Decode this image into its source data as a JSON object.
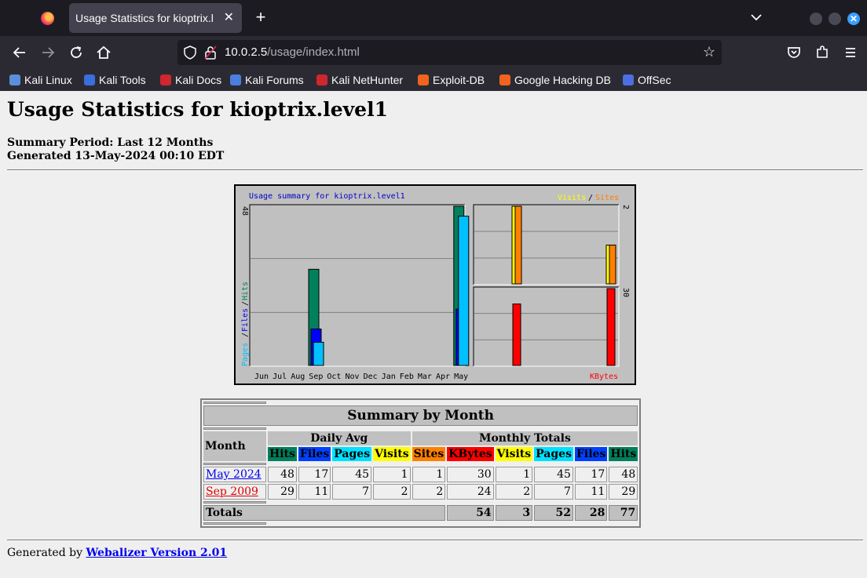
{
  "browser": {
    "tab_title": "Usage Statistics for kioptrix.l",
    "url_host": "10.0.2.5",
    "url_path": "/usage/index.html",
    "bookmarks": [
      {
        "label": "Kali Linux",
        "icon": "kali-dragon-icon",
        "color": "#5a8fdc"
      },
      {
        "label": "Kali Tools",
        "icon": "kali-tools-icon",
        "color": "#3b6edc"
      },
      {
        "label": "Kali Docs",
        "icon": "kali-docs-icon",
        "color": "#d0262e"
      },
      {
        "label": "Kali Forums",
        "icon": "kali-forums-icon",
        "color": "#4c7de0"
      },
      {
        "label": "Kali NetHunter",
        "icon": "nethunter-icon",
        "color": "#d0262e"
      },
      {
        "label": "Exploit-DB",
        "icon": "exploit-db-icon",
        "color": "#f0641e"
      },
      {
        "label": "Google Hacking DB",
        "icon": "ghdb-icon",
        "color": "#f0641e"
      },
      {
        "label": "OffSec",
        "icon": "offsec-icon",
        "color": "#4c6fe0"
      }
    ]
  },
  "page": {
    "title": "Usage Statistics for kioptrix.level1",
    "period": "Summary Period: Last 12 Months",
    "generated": "Generated 13-May-2024 00:10 EDT",
    "footer_prefix": "Generated by",
    "footer_link": "Webalizer Version 2.01"
  },
  "chart_data": {
    "type": "bar",
    "title": "Usage summary for kioptrix.level1",
    "legend_top_right": [
      "Visits",
      "/",
      "Sites"
    ],
    "left_axis_label": [
      "Pages",
      "/",
      "Files",
      "/",
      "Hits"
    ],
    "bottom_right_label": "KBytes",
    "categories": [
      "Jun",
      "Jul",
      "Aug",
      "Sep",
      "Oct",
      "Nov",
      "Dec",
      "Jan",
      "Feb",
      "Mar",
      "Apr",
      "May"
    ],
    "left_max_label": "48",
    "visits_max_label": "2",
    "kbytes_max_label": "30",
    "series": [
      {
        "name": "Hits",
        "color": "#00805c",
        "values": [
          0,
          0,
          0,
          29,
          0,
          0,
          0,
          0,
          0,
          0,
          0,
          48
        ]
      },
      {
        "name": "Files",
        "color": "#0000ff",
        "values": [
          0,
          0,
          0,
          11,
          0,
          0,
          0,
          0,
          0,
          0,
          0,
          17
        ]
      },
      {
        "name": "Pages",
        "color": "#00c0ff",
        "values": [
          0,
          0,
          0,
          7,
          0,
          0,
          0,
          0,
          0,
          0,
          0,
          45
        ]
      },
      {
        "name": "Visits",
        "color": "#ffff00",
        "values": [
          0,
          0,
          0,
          2,
          0,
          0,
          0,
          0,
          0,
          0,
          0,
          1
        ]
      },
      {
        "name": "Sites",
        "color": "#ff8000",
        "values": [
          0,
          0,
          0,
          2,
          0,
          0,
          0,
          0,
          0,
          0,
          0,
          1
        ]
      },
      {
        "name": "KBytes",
        "color": "#ff0000",
        "values": [
          0,
          0,
          0,
          24,
          0,
          0,
          0,
          0,
          0,
          0,
          0,
          30
        ]
      }
    ]
  },
  "summary_table": {
    "title": "Summary by Month",
    "month_header": "Month",
    "daily_avg_header": "Daily Avg",
    "monthly_totals_header": "Monthly Totals",
    "daily_cols": [
      "Hits",
      "Files",
      "Pages",
      "Visits"
    ],
    "monthly_cols": [
      "Sites",
      "KBytes",
      "Visits",
      "Pages",
      "Files",
      "Hits"
    ],
    "rows": [
      {
        "month": "May 2024",
        "values": [
          "48",
          "17",
          "45",
          "1",
          "1",
          "30",
          "1",
          "45",
          "17",
          "48"
        ]
      },
      {
        "month": "Sep 2009",
        "values": [
          "29",
          "11",
          "7",
          "2",
          "2",
          "24",
          "2",
          "7",
          "11",
          "29"
        ]
      }
    ],
    "totals_label": "Totals",
    "totals": [
      "54",
      "3",
      "52",
      "28",
      "77"
    ]
  }
}
